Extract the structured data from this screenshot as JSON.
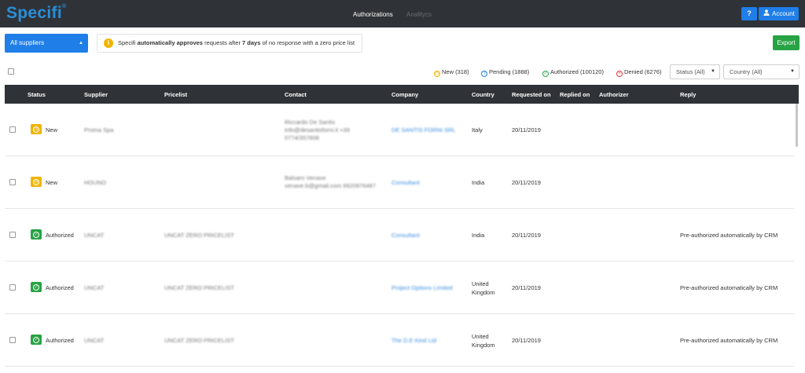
{
  "header": {
    "logo": "Specifi",
    "logo_mark": "®",
    "nav": [
      {
        "label": "Authorizations",
        "active": true
      },
      {
        "label": "Analitycs",
        "active": false
      }
    ],
    "help_label": "?",
    "account_label": "Account"
  },
  "toolbar": {
    "supplier_select": "All suppliers",
    "info": {
      "prefix": "Specifi",
      "strong1": "automatically approves",
      "mid": "requests after",
      "strong2": "7 days",
      "suffix": "of no response with a zero price list"
    },
    "export_label": "Export"
  },
  "legend": [
    {
      "label": "New (318)",
      "color": "#f0b400"
    },
    {
      "label": "Pending (1888)",
      "color": "#1f7ee8"
    },
    {
      "label": "Authorized (100120)",
      "color": "#27a344"
    },
    {
      "label": "Denied (6276)",
      "color": "#e03a3a"
    }
  ],
  "filters": {
    "status": "Status (All)",
    "country": "Country (All)"
  },
  "table": {
    "columns": [
      "Status",
      "Supplier",
      "Pricelist",
      "Contact",
      "Company",
      "Country",
      "Requested on",
      "Replied on",
      "Authorizer",
      "Reply"
    ],
    "rows": [
      {
        "status": "New",
        "status_type": "new",
        "supplier": "Proma Spa",
        "pricelist": "",
        "contact": [
          "Riccardo De Santis",
          "info@desantisforni.it +39",
          "0774/357808"
        ],
        "company": "DE SANTIS FORNI SRL",
        "country": [
          "Italy"
        ],
        "requested": "20/11/2019",
        "replied": "",
        "authorizer": "",
        "reply": ""
      },
      {
        "status": "New",
        "status_type": "new",
        "supplier": "HOUNO",
        "pricelist": "",
        "contact": [
          "Balsaro Venave",
          "venave.b@gmail.com 9920976487"
        ],
        "company": "Consultant",
        "country": [
          "India"
        ],
        "requested": "20/11/2019",
        "replied": "",
        "authorizer": "",
        "reply": ""
      },
      {
        "status": "Authorized",
        "status_type": "auth",
        "supplier": "UNCAT",
        "pricelist": "UNCAT ZERO PRICELIST",
        "contact": [],
        "company": "Consultant",
        "country": [
          "India"
        ],
        "requested": "20/11/2019",
        "replied": "",
        "authorizer": "",
        "reply": "Pre-authorized automatically by CRM"
      },
      {
        "status": "Authorized",
        "status_type": "auth",
        "supplier": "UNCAT",
        "pricelist": "UNCAT ZERO PRICELIST",
        "contact": [],
        "company": "Project Options Limited",
        "country": [
          "United",
          "Kingdom"
        ],
        "requested": "20/11/2019",
        "replied": "",
        "authorizer": "",
        "reply": "Pre-authorized automatically by CRM"
      },
      {
        "status": "Authorized",
        "status_type": "auth",
        "supplier": "UNCAT",
        "pricelist": "UNCAT ZERO PRICELIST",
        "contact": [],
        "company": "The D.E Kind Ltd",
        "country": [
          "United",
          "Kingdom"
        ],
        "requested": "20/11/2019",
        "replied": "",
        "authorizer": "",
        "reply": "Pre-authorized automatically by CRM"
      }
    ]
  }
}
